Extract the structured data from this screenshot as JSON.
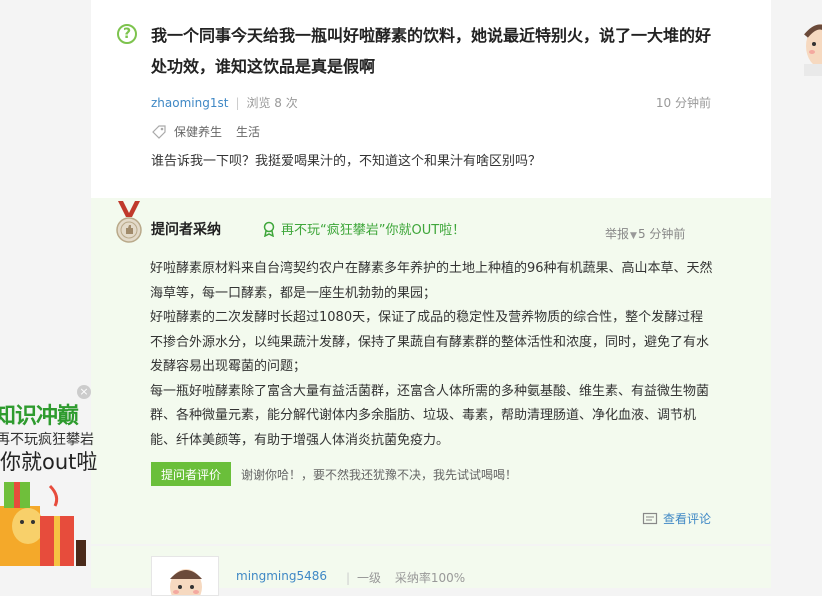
{
  "question": {
    "title": "我一个同事今天给我一瓶叫好啦酵素的饮料，她说最近特别火，说了一大堆的好处功效，谁知这饮品是真是假啊",
    "icon_char": "?",
    "author": "zhaoming1st",
    "views": "浏览 8 次",
    "time": "10 分钟前",
    "tags": [
      "保健养生",
      "生活"
    ],
    "description": "谁告诉我一下呗？我挺爱喝果汁的，不知道这个和果汁有啥区别吗？"
  },
  "best_answer": {
    "label": "提问者采纳",
    "promo": "再不玩“疯狂攀岩”你就OUT啦！",
    "report": "举报",
    "time": "5 分钟前",
    "paragraphs": [
      "好啦酵素原材料来自台湾契约农户在酵素多年养护的土地上种植的96种有机蔬果、高山本草、天然海草等，每一口酵素，都是一座生机勃勃的果园；",
      "好啦酵素的二次发酵时长超过1080天，保证了成品的稳定性及营养物质的综合性，整个发酵过程不掺合外源水分，以纯果蔬汁发酵，保持了果蔬自有酵素群的整体活性和浓度，同时，避免了有水发酵容易出现霉菌的问题；",
      "每一瓶好啦酵素除了富含大量有益活菌群，还富含人体所需的多种氨基酸、维生素、有益微生物菌群、各种微量元素，能分解代谢体内多余脂肪、垃圾、毒素，帮助清理肠道、净化血液、调节机能、纤体美颜等，有助于增强人体消炎抗菌免疫力。"
    ],
    "eval_button": "提问者评价",
    "eval_text": "谢谢你哈！，要不然我还犹豫不决，我先试试喝喝！",
    "view_comments": "查看评论"
  },
  "next_answer": {
    "author": "mingming5486",
    "level": "一级",
    "adoption": "采纳率100%"
  },
  "ad": {
    "line1": "知识冲巅",
    "line2": "再不玩疯狂攀岩",
    "line3": "你就out啦",
    "close": "×"
  },
  "colors": {
    "accent_green": "#6abf3a",
    "link_blue": "#3f88c5",
    "answer_bg": "#f3faee"
  }
}
